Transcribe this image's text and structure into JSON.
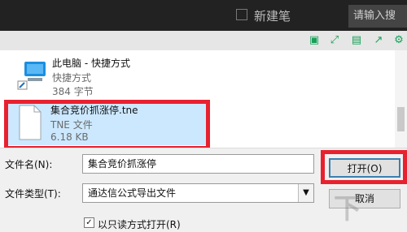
{
  "app": {
    "title": "新建笔",
    "search_placeholder": "请输入搜"
  },
  "toolbar_icons": [
    "clipboard-icon",
    "expand-icon",
    "save-icon",
    "share-icon",
    "gear-icon"
  ],
  "files": [
    {
      "name": "此电脑 - 快捷方式",
      "type": "快捷方式",
      "size": "384 字节"
    },
    {
      "name": "集合竞价抓涨停.tne",
      "type": "TNE 文件",
      "size": "6.18 KB"
    }
  ],
  "form": {
    "filename_label": "文件名(N):",
    "filename_value": "集合竞价抓涨停",
    "filetype_label": "文件类型(T):",
    "filetype_value": "通达信公式导出文件",
    "open_button": "打开(O)",
    "cancel_button": "取消",
    "readonly_label": "以只读方式打开(R)"
  },
  "colors": {
    "highlight": "#e8212f",
    "selection": "#cce8ff",
    "icon_green": "#18a058"
  }
}
